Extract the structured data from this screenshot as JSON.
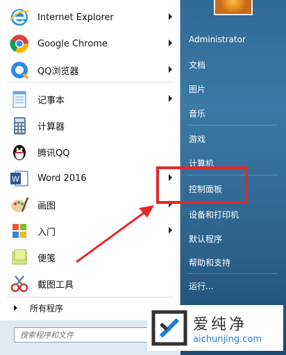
{
  "programs": [
    {
      "label": "Internet Explorer",
      "icon": "internet-explorer-icon",
      "has_arrow": true
    },
    {
      "label": "Google Chrome",
      "icon": "chrome-icon",
      "has_arrow": true
    },
    {
      "label": "QQ浏览器",
      "icon": "qq-browser-icon",
      "has_arrow": true
    },
    {
      "label": "记事本",
      "icon": "notepad-icon",
      "has_arrow": true
    },
    {
      "label": "计算器",
      "icon": "calculator-icon",
      "has_arrow": false
    },
    {
      "label": "腾讯QQ",
      "icon": "qq-penguin-icon",
      "has_arrow": false
    },
    {
      "label": "Word 2016",
      "icon": "word-icon",
      "has_arrow": true
    },
    {
      "label": "画图",
      "icon": "paint-icon",
      "has_arrow": true
    },
    {
      "label": "入门",
      "icon": "getting-started-icon",
      "has_arrow": true
    },
    {
      "label": "便笺",
      "icon": "sticky-notes-icon",
      "has_arrow": false
    },
    {
      "label": "截图工具",
      "icon": "snipping-tool-icon",
      "has_arrow": false
    }
  ],
  "all_programs_label": "所有程序",
  "search": {
    "placeholder": "搜索程序和文件"
  },
  "right_items": [
    {
      "label": "Administrator"
    },
    {
      "label": "文档"
    },
    {
      "label": "图片"
    },
    {
      "label": "音乐"
    },
    {
      "label": "游戏"
    },
    {
      "label": "计算机"
    },
    {
      "label": "控制面板"
    },
    {
      "label": "设备和打印机"
    },
    {
      "label": "默认程序"
    },
    {
      "label": "帮助和支持"
    },
    {
      "label": "运行..."
    }
  ],
  "watermark": {
    "cn": "爱纯净",
    "url": "aichunjing.com"
  },
  "colors": {
    "highlight": "#e3272a",
    "panel_blue": "#2f6a95"
  }
}
